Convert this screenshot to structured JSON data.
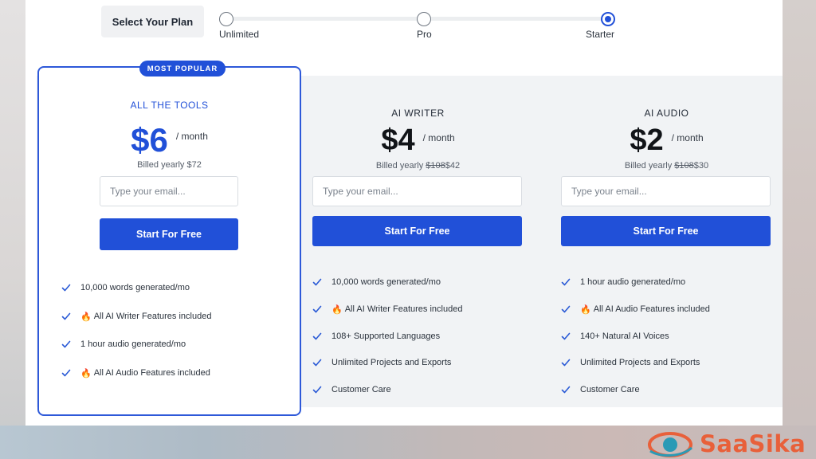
{
  "plan_selector": {
    "title": "Select Your Plan",
    "options": [
      {
        "label": "Unlimited",
        "selected": false
      },
      {
        "label": "Pro",
        "selected": false
      },
      {
        "label": "Starter",
        "selected": true
      }
    ]
  },
  "plans": [
    {
      "badge": "MOST POPULAR",
      "name": "ALL THE TOOLS",
      "price": "$6",
      "period": "/ month",
      "billed_prefix": "Billed yearly",
      "billed_old": "",
      "billed_new": "$72",
      "email_placeholder": "Type your email...",
      "cta": "Start For Free",
      "features": [
        {
          "emoji": "",
          "text": "10,000 words generated/mo"
        },
        {
          "emoji": "🔥",
          "text": "All AI Writer Features included"
        },
        {
          "emoji": "",
          "text": "1 hour audio generated/mo"
        },
        {
          "emoji": "🔥",
          "text": "All AI Audio Features included"
        }
      ]
    },
    {
      "name": "AI WRITER",
      "price": "$4",
      "period": "/ month",
      "billed_prefix": "Billed yearly",
      "billed_old": "$108",
      "billed_new": "$42",
      "email_placeholder": "Type your email...",
      "cta": "Start For Free",
      "features": [
        {
          "emoji": "",
          "text": "10,000 words generated/mo"
        },
        {
          "emoji": "🔥",
          "text": "All AI Writer Features included"
        },
        {
          "emoji": "",
          "text": "108+ Supported Languages"
        },
        {
          "emoji": "",
          "text": "Unlimited Projects and Exports"
        },
        {
          "emoji": "",
          "text": "Customer Care"
        }
      ]
    },
    {
      "name": "AI AUDIO",
      "price": "$2",
      "period": "/ month",
      "billed_prefix": "Billed yearly",
      "billed_old": "$108",
      "billed_new": "$30",
      "email_placeholder": "Type your email...",
      "cta": "Start For Free",
      "features": [
        {
          "emoji": "",
          "text": "1 hour audio generated/mo"
        },
        {
          "emoji": "🔥",
          "text": "All AI Audio Features included"
        },
        {
          "emoji": "",
          "text": "140+ Natural AI Voices"
        },
        {
          "emoji": "",
          "text": "Unlimited Projects and Exports"
        },
        {
          "emoji": "",
          "text": "Customer Care"
        }
      ]
    }
  ],
  "watermark": {
    "text": "SaaSika"
  },
  "colors": {
    "accent": "#2150d8",
    "check": "#2a5ad6",
    "popular_name": "#2150d8",
    "price_popular": "#2150d8",
    "price": "#111418",
    "watermark": "#e8603a"
  }
}
